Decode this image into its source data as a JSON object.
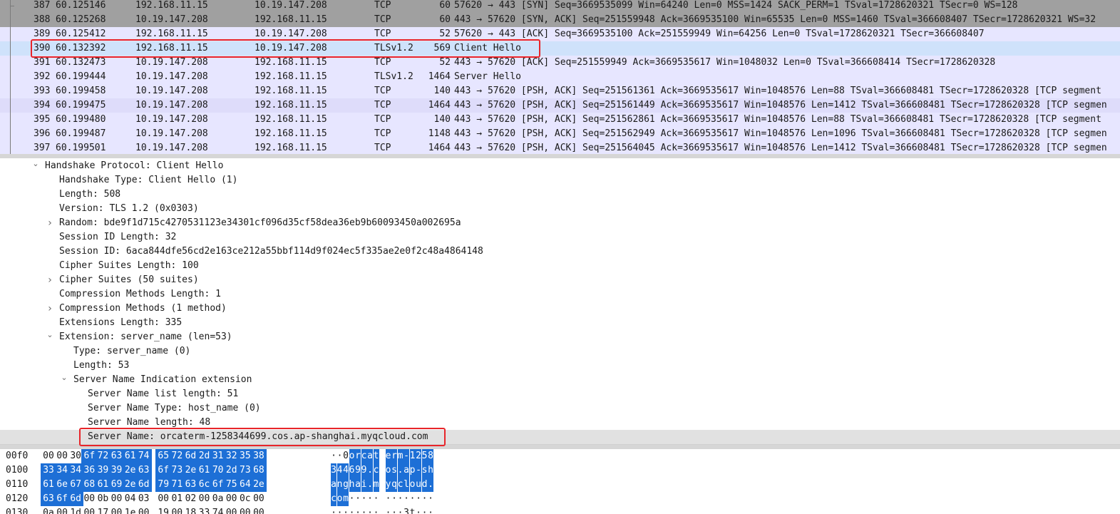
{
  "packet_list": {
    "rows": [
      {
        "no": "387",
        "time": "60.125146",
        "src": "192.168.11.15",
        "dst": "10.19.147.208",
        "proto": "TCP",
        "len": "60",
        "info": "57620 → 443 [SYN] Seq=3669535099 Win=64240 Len=0 MSS=1424 SACK_PERM=1 TSval=1728620321 TSecr=0 WS=128",
        "style": "tcp-handshake"
      },
      {
        "no": "388",
        "time": "60.125268",
        "src": "10.19.147.208",
        "dst": "192.168.11.15",
        "proto": "TCP",
        "len": "60",
        "info": "443 → 57620 [SYN, ACK] Seq=251559948 Ack=3669535100 Win=65535 Len=0 MSS=1460 TSval=366608407 TSecr=1728620321 WS=32",
        "style": "tcp-handshake"
      },
      {
        "no": "389",
        "time": "60.125412",
        "src": "192.168.11.15",
        "dst": "10.19.147.208",
        "proto": "TCP",
        "len": "52",
        "info": "57620 → 443 [ACK] Seq=3669535100 Ack=251559949 Win=64256 Len=0 TSval=1728620321 TSecr=366608407",
        "style": "tcp-normal"
      },
      {
        "no": "390",
        "time": "60.132392",
        "src": "192.168.11.15",
        "dst": "10.19.147.208",
        "proto": "TLSv1.2",
        "len": "569",
        "info": "Client Hello",
        "style": "selected"
      },
      {
        "no": "391",
        "time": "60.132473",
        "src": "10.19.147.208",
        "dst": "192.168.11.15",
        "proto": "TCP",
        "len": "52",
        "info": "443 → 57620 [ACK] Seq=251559949 Ack=3669535617 Win=1048032 Len=0 TSval=366608414 TSecr=1728620328",
        "style": "tcp-normal"
      },
      {
        "no": "392",
        "time": "60.199444",
        "src": "10.19.147.208",
        "dst": "192.168.11.15",
        "proto": "TLSv1.2",
        "len": "1464",
        "info": "Server Hello",
        "style": "tcp-normal"
      },
      {
        "no": "393",
        "time": "60.199458",
        "src": "10.19.147.208",
        "dst": "192.168.11.15",
        "proto": "TCP",
        "len": "140",
        "info": "443 → 57620 [PSH, ACK] Seq=251561361 Ack=3669535617 Win=1048576 Len=88 TSval=366608481 TSecr=1728620328 [TCP segment",
        "style": "tcp-normal"
      },
      {
        "no": "394",
        "time": "60.199475",
        "src": "10.19.147.208",
        "dst": "192.168.11.15",
        "proto": "TCP",
        "len": "1464",
        "info": "443 → 57620 [PSH, ACK] Seq=251561449 Ack=3669535617 Win=1048576 Len=1412 TSval=366608481 TSecr=1728620328 [TCP segmen",
        "style": "tcp-alt"
      },
      {
        "no": "395",
        "time": "60.199480",
        "src": "10.19.147.208",
        "dst": "192.168.11.15",
        "proto": "TCP",
        "len": "140",
        "info": "443 → 57620 [PSH, ACK] Seq=251562861 Ack=3669535617 Win=1048576 Len=88 TSval=366608481 TSecr=1728620328 [TCP segment",
        "style": "tcp-normal"
      },
      {
        "no": "396",
        "time": "60.199487",
        "src": "10.19.147.208",
        "dst": "192.168.11.15",
        "proto": "TCP",
        "len": "1148",
        "info": "443 → 57620 [PSH, ACK] Seq=251562949 Ack=3669535617 Win=1048576 Len=1096 TSval=366608481 TSecr=1728620328 [TCP segmen",
        "style": "tcp-normal"
      },
      {
        "no": "397",
        "time": "60.199501",
        "src": "10.19.147.208",
        "dst": "192.168.11.15",
        "proto": "TCP",
        "len": "1464",
        "info": "443 → 57620 [PSH, ACK] Seq=251564045 Ack=3669535617 Win=1048576 Len=1412 TSval=366608481 TSecr=1728620328 [TCP segmen",
        "style": "tcp-normal"
      }
    ]
  },
  "details": {
    "rows": [
      {
        "level": 1,
        "arrow": "expanded",
        "text": "Handshake Protocol: Client Hello"
      },
      {
        "level": 2,
        "arrow": "none",
        "text": "Handshake Type: Client Hello (1)"
      },
      {
        "level": 2,
        "arrow": "none",
        "text": "Length: 508"
      },
      {
        "level": 2,
        "arrow": "none",
        "text": "Version: TLS 1.2 (0x0303)"
      },
      {
        "level": 2,
        "arrow": "collapsed",
        "text": "Random: bde9f1d715c4270531123e34301cf096d35cf58dea36eb9b60093450a002695a"
      },
      {
        "level": 2,
        "arrow": "none",
        "text": "Session ID Length: 32"
      },
      {
        "level": 2,
        "arrow": "none",
        "text": "Session ID: 6aca844dfe56cd2e163ce212a55bbf114d9f024ec5f335ae2e0f2c48a4864148"
      },
      {
        "level": 2,
        "arrow": "none",
        "text": "Cipher Suites Length: 100"
      },
      {
        "level": 2,
        "arrow": "collapsed",
        "text": "Cipher Suites (50 suites)"
      },
      {
        "level": 2,
        "arrow": "none",
        "text": "Compression Methods Length: 1"
      },
      {
        "level": 2,
        "arrow": "collapsed",
        "text": "Compression Methods (1 method)"
      },
      {
        "level": 2,
        "arrow": "none",
        "text": "Extensions Length: 335"
      },
      {
        "level": 2,
        "arrow": "expanded",
        "text": "Extension: server_name (len=53)"
      },
      {
        "level": 3,
        "arrow": "none",
        "text": "Type: server_name (0)"
      },
      {
        "level": 3,
        "arrow": "none",
        "text": "Length: 53"
      },
      {
        "level": 3,
        "arrow": "expanded",
        "text": "Server Name Indication extension"
      },
      {
        "level": 4,
        "arrow": "none",
        "text": "Server Name list length: 51"
      },
      {
        "level": 4,
        "arrow": "none",
        "text": "Server Name Type: host_name (0)"
      },
      {
        "level": 4,
        "arrow": "none",
        "text": "Server Name length: 48"
      },
      {
        "level": 4,
        "arrow": "none",
        "text": "Server Name: orcaterm-1258344699.cos.ap-shanghai.myqcloud.com",
        "selected": true
      }
    ]
  },
  "hex": {
    "rows": [
      {
        "offset": "00f0",
        "bytes": [
          "00",
          "00",
          "30",
          "6f",
          "72",
          "63",
          "61",
          "74",
          "65",
          "72",
          "6d",
          "2d",
          "31",
          "32",
          "35",
          "38"
        ],
        "ascii": "··0orcaterm-1258",
        "sel_from": 3,
        "sel_to": 15
      },
      {
        "offset": "0100",
        "bytes": [
          "33",
          "34",
          "34",
          "36",
          "39",
          "39",
          "2e",
          "63",
          "6f",
          "73",
          "2e",
          "61",
          "70",
          "2d",
          "73",
          "68"
        ],
        "ascii": "344699.cos.ap-sh",
        "sel_from": 0,
        "sel_to": 15
      },
      {
        "offset": "0110",
        "bytes": [
          "61",
          "6e",
          "67",
          "68",
          "61",
          "69",
          "2e",
          "6d",
          "79",
          "71",
          "63",
          "6c",
          "6f",
          "75",
          "64",
          "2e"
        ],
        "ascii": "anghai.myqcloud.",
        "sel_from": 0,
        "sel_to": 15
      },
      {
        "offset": "0120",
        "bytes": [
          "63",
          "6f",
          "6d",
          "00",
          "0b",
          "00",
          "04",
          "03",
          "00",
          "01",
          "02",
          "00",
          "0a",
          "00",
          "0c",
          "00"
        ],
        "ascii": "com·············",
        "sel_from": 0,
        "sel_to": 2
      },
      {
        "offset": "0130",
        "bytes": [
          "0a",
          "00",
          "1d",
          "00",
          "17",
          "00",
          "1e",
          "00",
          "19",
          "00",
          "18",
          "33",
          "74",
          "00",
          "00",
          "00"
        ],
        "ascii": "···········3t···",
        "sel_from": -1,
        "sel_to": -1
      }
    ]
  },
  "colors": {
    "highlight_box": "#e8252a",
    "selected_packet": "#cfe2fb",
    "tcp_handshake": "#a0a0a0",
    "tcp_row": "#e7e6ff",
    "hex_selection": "#1d6fd6",
    "selected_field": "#e1e1e1"
  }
}
